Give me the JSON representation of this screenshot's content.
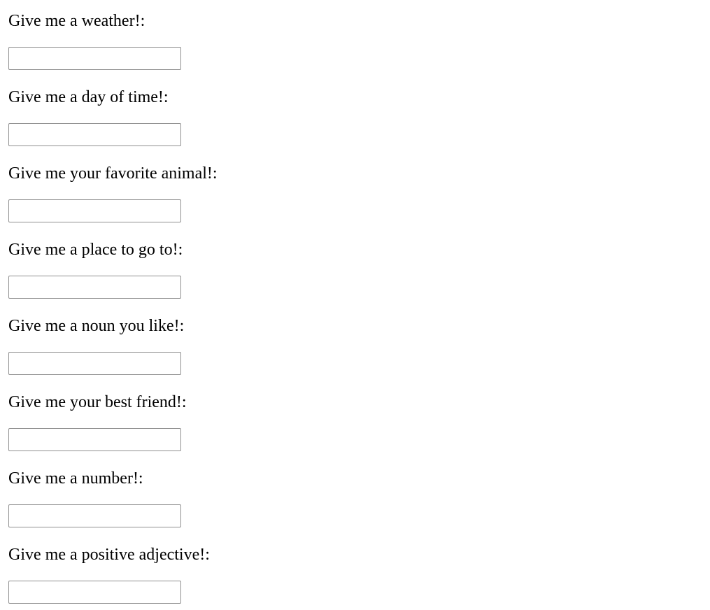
{
  "form": {
    "fields": [
      {
        "label": "Give me a weather!:",
        "value": ""
      },
      {
        "label": "Give me a day of time!:",
        "value": ""
      },
      {
        "label": "Give me your favorite animal!:",
        "value": ""
      },
      {
        "label": "Give me a place to go to!:",
        "value": ""
      },
      {
        "label": "Give me a noun you like!:",
        "value": ""
      },
      {
        "label": "Give me your best friend!:",
        "value": ""
      },
      {
        "label": "Give me a number!:",
        "value": ""
      },
      {
        "label": "Give me a positive adjective!:",
        "value": ""
      }
    ]
  }
}
